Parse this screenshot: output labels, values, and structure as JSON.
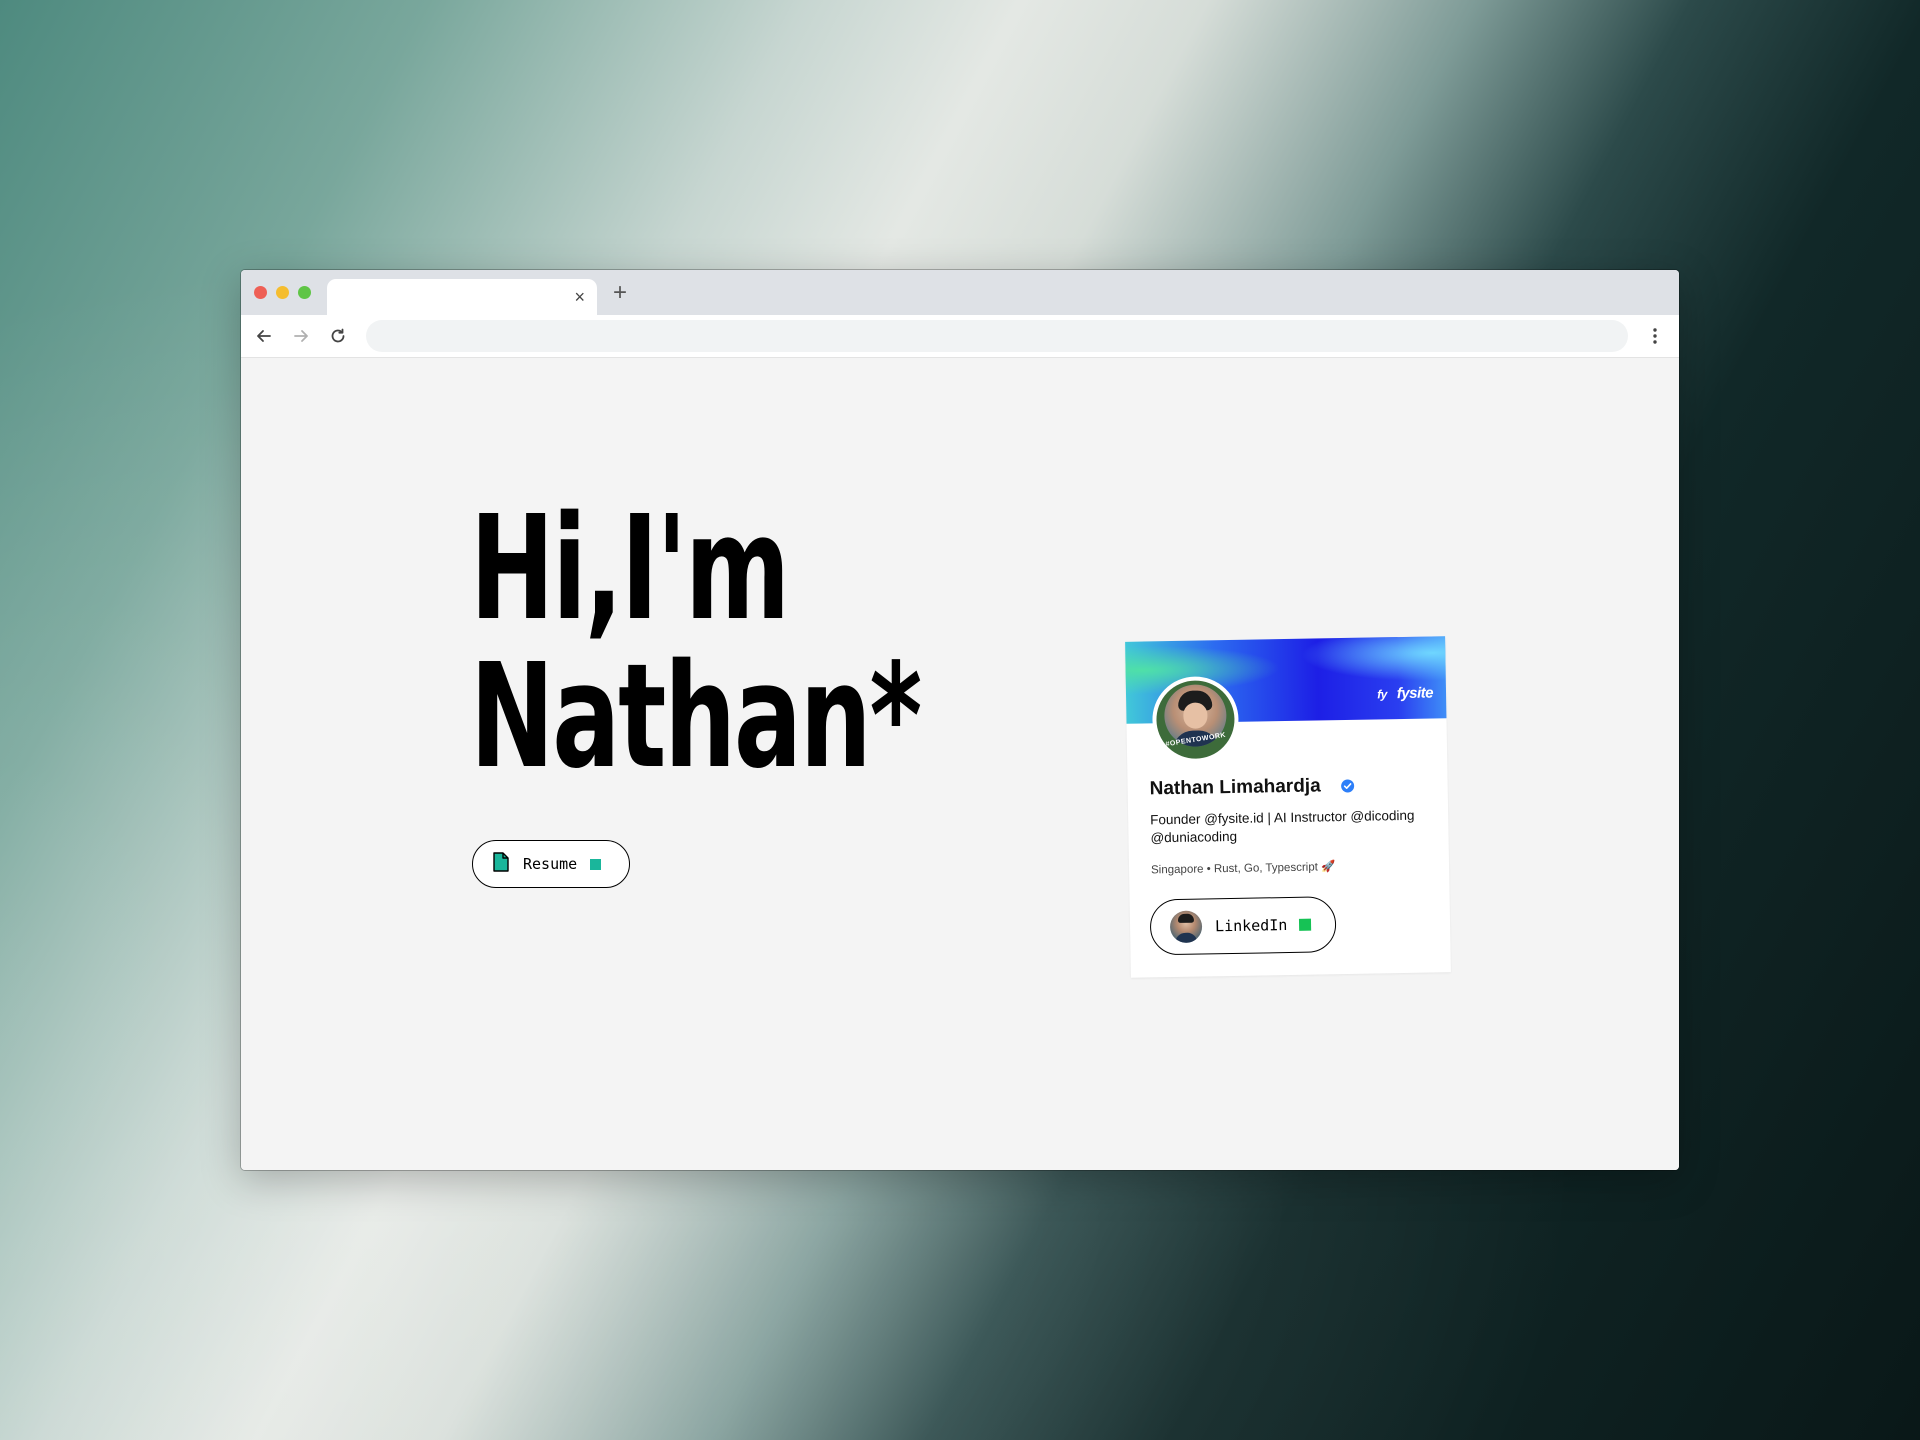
{
  "browser": {
    "tab_title": "",
    "tab_close_icon": "close-icon",
    "new_tab_icon": "plus-icon",
    "address_value": "",
    "nav_icons": [
      "arrow-left-icon",
      "arrow-right-icon",
      "reload-icon",
      "kebab-menu-icon"
    ]
  },
  "hero": {
    "line1": "Hi,I'm",
    "line2": "Nathan*"
  },
  "resume_button": {
    "label": "Resume",
    "icon": "document-icon",
    "accent_color": "#1ab69b"
  },
  "profile_card": {
    "brand_mark": "fy",
    "brand_name": "fysite",
    "avatar_badge": "#OPENTOWORK",
    "name": "Nathan Limahardja",
    "verified_icon": "verified-badge-icon",
    "bio": "Founder @fysite.id | AI Instructor @dicoding @duniacoding",
    "meta": "Singapore • Rust, Go, Typescript 🚀",
    "linkedin_button": {
      "label": "LinkedIn",
      "accent_color": "#16c255"
    }
  },
  "colors": {
    "page_background": "#f4f4f4",
    "banner_blue": "#1d1fe6",
    "text": "#000000"
  }
}
